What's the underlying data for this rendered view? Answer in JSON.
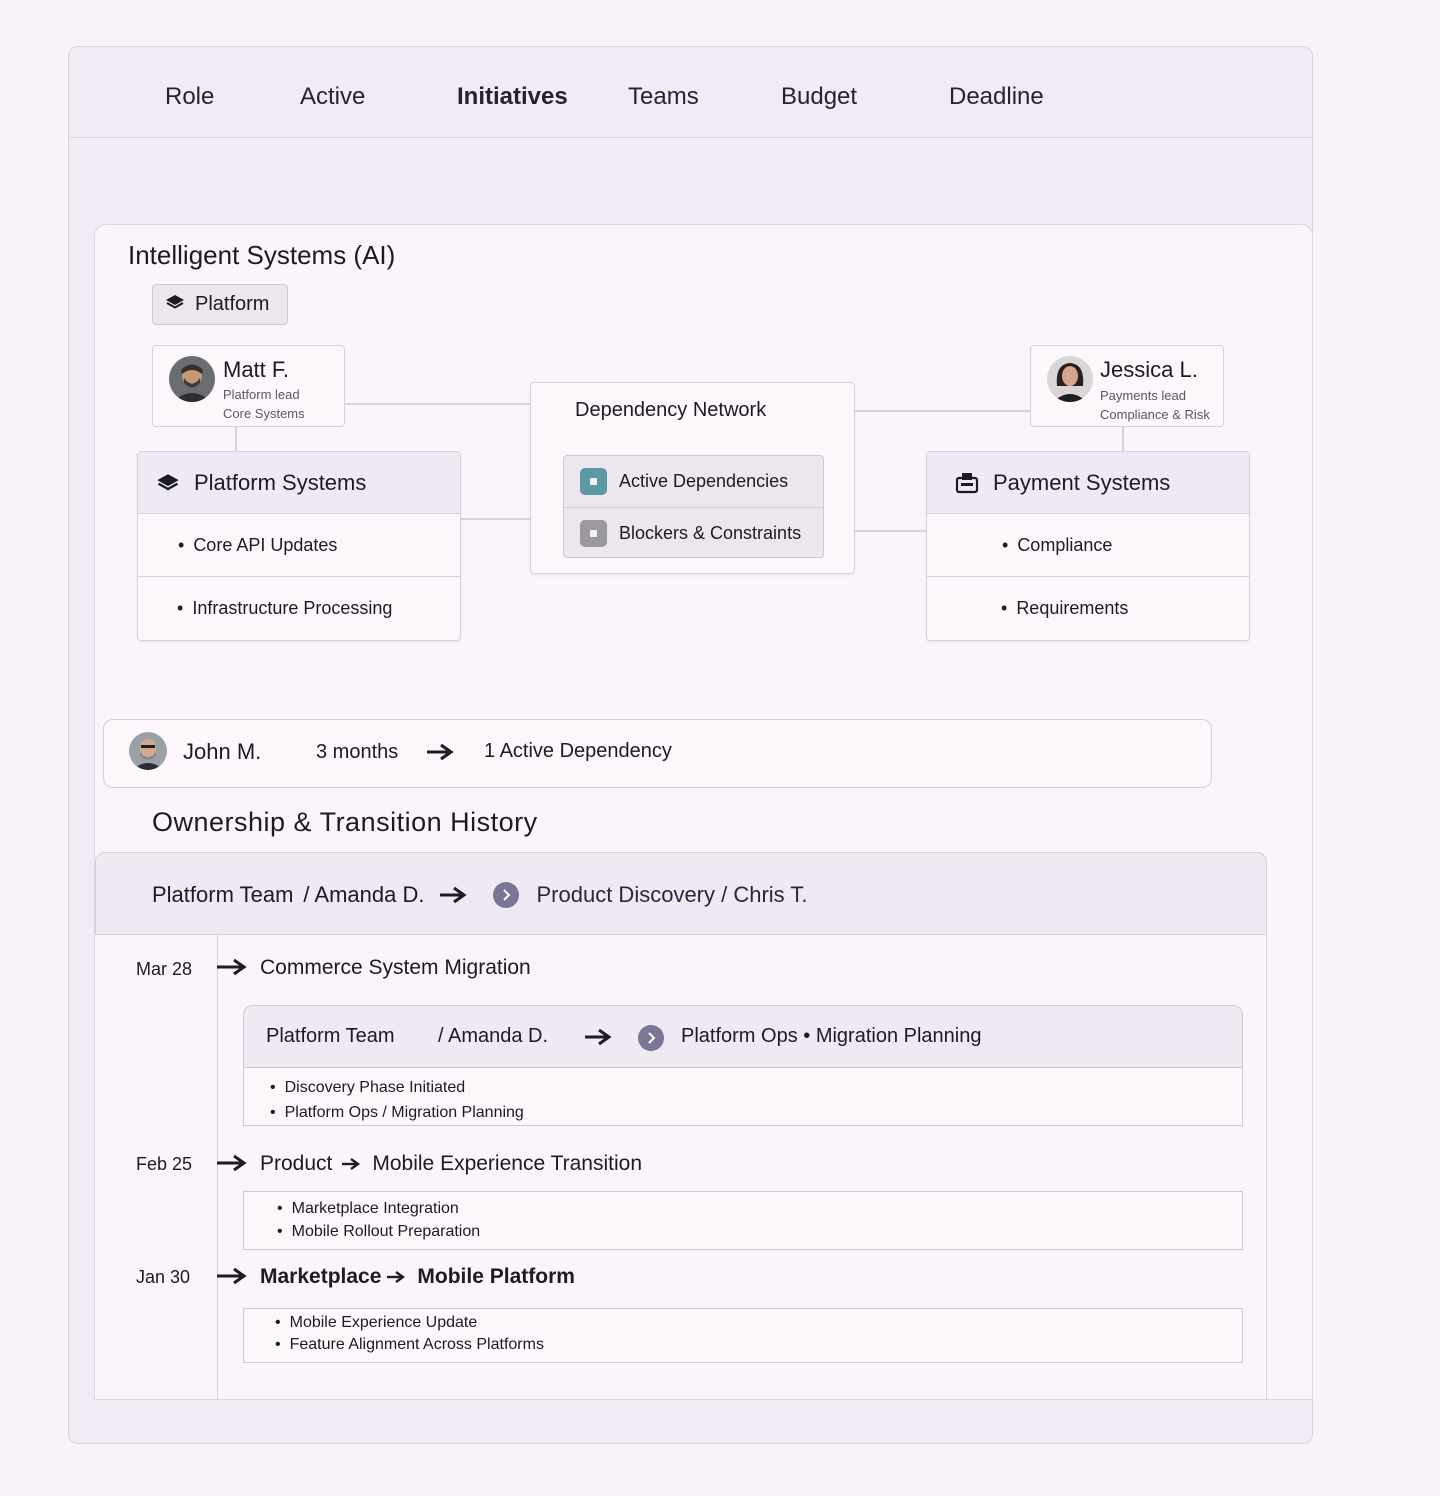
{
  "tabs": {
    "role": "Role",
    "active": "Active",
    "initiatives": "Initiatives",
    "teams": "Teams",
    "budget": "Budget",
    "deadline": "Deadline"
  },
  "section": {
    "title": "Intelligent Systems (AI)",
    "chip": "Platform"
  },
  "people": {
    "matt": {
      "name": "Matt F.",
      "role": "Platform lead",
      "team": "Core Systems"
    },
    "jessica": {
      "name": "Jessica L.",
      "role": "Payments lead",
      "team": "Compliance & Risk"
    }
  },
  "platform_systems": {
    "title": "Platform Systems",
    "items": [
      "Core API Updates",
      "Infrastructure Processing"
    ]
  },
  "payment_systems": {
    "title": "Payment Systems",
    "items": [
      "Compliance",
      "Requirements"
    ]
  },
  "dependency_network": {
    "title": "Dependency Network",
    "items": [
      "Active Dependencies",
      "Blockers & Constraints"
    ],
    "colors": [
      "#5b9aa5",
      "#9b989e"
    ]
  },
  "john_bar": {
    "name": "John M.",
    "duration": "3 months",
    "dependency": "1 Active Dependency"
  },
  "history": {
    "title": "Ownership & Transition History",
    "header": {
      "from_team": "Platform Team",
      "from_person": "/ Amanda D.",
      "to": "Product Discovery / Chris T."
    },
    "entries": [
      {
        "date": "Mar 28",
        "title": "Commerce System Migration",
        "sub_from_team": "Platform Team",
        "sub_from_person": "/ Amanda D.",
        "sub_to": "Platform Ops • Migration Planning",
        "items": [
          "Discovery Phase Initiated",
          "Platform Ops / Migration Planning"
        ]
      },
      {
        "date": "Feb 25",
        "from": "Product",
        "to": "Mobile Experience Transition",
        "items": [
          "Marketplace Integration",
          "Mobile Rollout Preparation"
        ]
      },
      {
        "date": "Jan 30",
        "from": "Marketplace",
        "to": "Mobile Platform",
        "items": [
          "Mobile Experience Update",
          "Feature Alignment Across Platforms"
        ]
      }
    ]
  }
}
